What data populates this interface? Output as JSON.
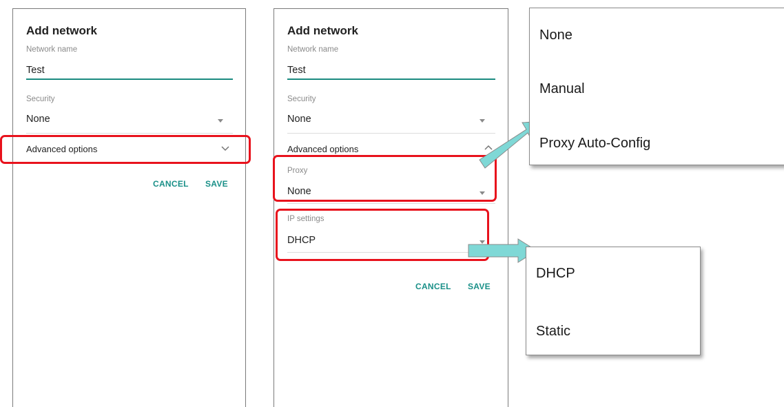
{
  "left_dialog": {
    "title": "Add network",
    "network_name_label": "Network name",
    "network_name_value": "Test",
    "security_label": "Security",
    "security_value": "None",
    "advanced_label": "Advanced options",
    "cancel_label": "CANCEL",
    "save_label": "SAVE"
  },
  "right_dialog": {
    "title": "Add network",
    "network_name_label": "Network name",
    "network_name_value": "Test",
    "security_label": "Security",
    "security_value": "None",
    "advanced_label": "Advanced options",
    "proxy_label": "Proxy",
    "proxy_value": "None",
    "ip_label": "IP settings",
    "ip_value": "DHCP",
    "cancel_label": "CANCEL",
    "save_label": "SAVE"
  },
  "proxy_menu": {
    "options": [
      "None",
      "Manual",
      "Proxy Auto-Config"
    ]
  },
  "ip_menu": {
    "options": [
      "DHCP",
      "Static"
    ]
  },
  "colors": {
    "accent": "#1a9088",
    "highlight": "#e8121c",
    "callout_arrow": "#7fd8d6"
  },
  "icons": {
    "dropdown": "triangle-down-icon",
    "expand": "chevron-down-icon",
    "collapse": "chevron-up-icon"
  }
}
